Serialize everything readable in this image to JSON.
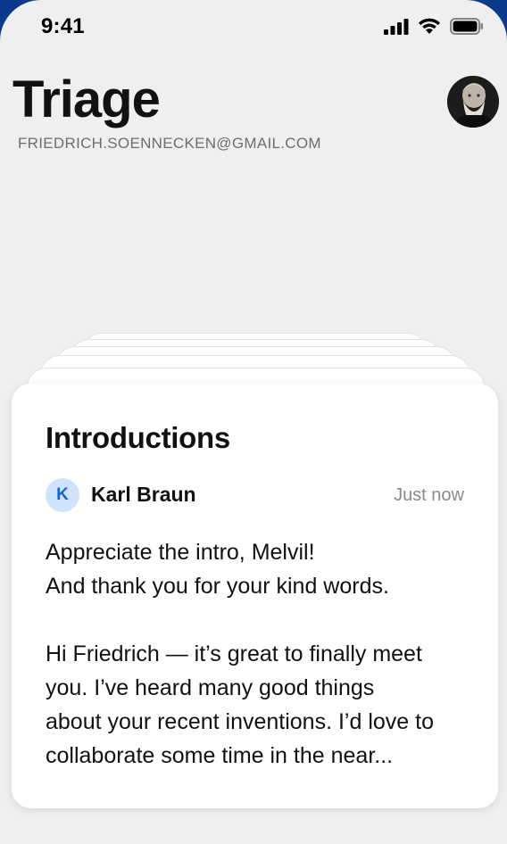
{
  "status_bar": {
    "time": "9:41",
    "icons": [
      "signal-icon",
      "wifi-icon",
      "battery-icon"
    ]
  },
  "header": {
    "title": "Triage",
    "account_email": "FRIEDRICH.SOENNECKEN@GMAIL.COM"
  },
  "card": {
    "title": "Introductions",
    "sender_initial": "K",
    "sender_name": "Karl Braun",
    "timestamp": "Just now",
    "body_lines": [
      "Appreciate the intro, Melvil!",
      "And thank you for your kind words.",
      "",
      "Hi Friedrich — it’s great to finally meet",
      "you. I’ve heard many good things",
      "about your recent inventions. I’d love to",
      "collaborate some time in the near..."
    ]
  },
  "colors": {
    "background": "#efefef",
    "card": "#ffffff",
    "sender_avatar_bg": "#cfe3ff",
    "sender_avatar_text": "#1463d6",
    "frame": "#0b3a8c"
  }
}
